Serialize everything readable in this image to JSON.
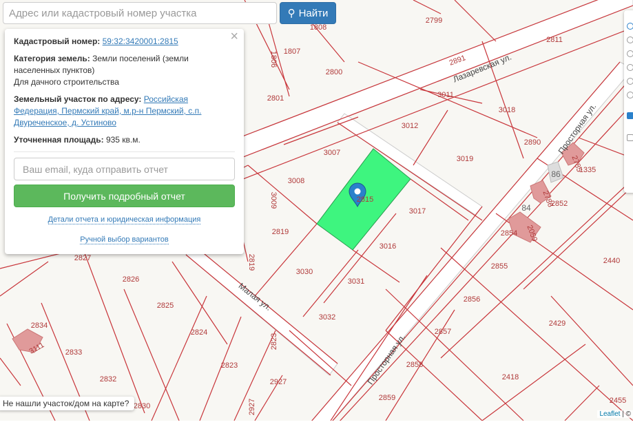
{
  "search": {
    "placeholder": "Адрес или кадастровый номер участка",
    "button": "Найти"
  },
  "popup": {
    "cad_label": "Кадастровый номер:",
    "cad_value": "59:32:3420001:2815",
    "cat_label": "Категория земель:",
    "cat_value": "Земли поселений (земли населенных пунктов)",
    "use": "Для дачного строительства",
    "addr_label": "Земельный участок по адресу:",
    "addr_value": "Российская Федерация, Пермский край, м.р-н Пермский, с.п. Двуреченское, д. Устиново",
    "area_label": "Уточненная площадь:",
    "area_value": "935 кв.м.",
    "email_placeholder": "Ваш email, куда отправить отчет",
    "report_button": "Получить подробный отчет",
    "details_link": "Детали отчета и юридическая информация",
    "manual_link": "Ручной выбор вариантов",
    "close": "×"
  },
  "map": {
    "parcels": [
      "1808",
      "2799",
      "2811",
      "1806",
      "1807",
      "2891",
      "2800",
      "2801",
      "3011",
      "3018",
      "3012",
      "2890",
      "3007",
      "3019",
      "1335",
      "3008",
      "3009",
      "2852",
      "3017",
      "2819",
      "2854",
      "3016",
      "2819",
      "2827",
      "2440",
      "2855",
      "3030",
      "2826",
      "3031",
      "2856",
      "2825",
      "3032",
      "2429",
      "2834",
      "2857",
      "2824",
      "2823",
      "2833",
      "2823",
      "2858",
      "2927",
      "2832",
      "2418",
      "2859",
      "2927",
      "2830",
      "2455",
      "2815",
      "2785",
      "2786",
      "2059",
      "3111"
    ],
    "streets": [
      "Лазаревская ул.",
      "Просторная ул.",
      "Просторная ул.",
      "Малая ул."
    ],
    "house_numbers": [
      "86",
      "84"
    ],
    "selected_color": "#3ef57f",
    "line_color": "#c8353a"
  },
  "question": "Не нашли участок/дом на карте?",
  "attribution": {
    "leaflet": "Leaflet",
    "sep": " | © "
  }
}
